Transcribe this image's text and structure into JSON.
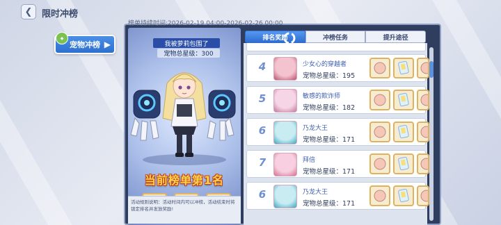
{
  "header": {
    "back_icon": "chevron-left-icon",
    "title": "限时冲榜",
    "period": "榜单持续时间:2026-02-19 04:00-2026-02-26 00:00"
  },
  "side": {
    "tab_label": "宠物冲榜"
  },
  "showcase": {
    "player_name": "我被萝莉包围了",
    "stars": "宠物总星级：300",
    "rank_banner": "当前榜单第1名",
    "rules": "活动规则说明：活动时间内可以冲榜，活动结束时将锁定排名并发放奖励!"
  },
  "tabs": [
    {
      "label": "排名奖励",
      "active": true
    },
    {
      "label": "冲榜任务",
      "active": false
    },
    {
      "label": "提升途径",
      "active": false
    }
  ],
  "rankings": [
    {
      "rank": "4",
      "name": "少女心的穿越者",
      "stars": "宠物总星级：195"
    },
    {
      "rank": "5",
      "name": "敏感的欺诈师",
      "stars": "宠物总星级：182"
    },
    {
      "rank": "6",
      "name": "乃龙大王",
      "stars": "宠物总星级：171"
    },
    {
      "rank": "7",
      "name": "拜倍",
      "stars": "宠物总星级：171"
    },
    {
      "rank": "6",
      "name": "乃龙大王",
      "stars": "宠物总星级：171"
    }
  ],
  "colors": {
    "accent_blue": "#2f6dd0",
    "gold": "#ffd24a",
    "frame": "#2f3e5e"
  }
}
